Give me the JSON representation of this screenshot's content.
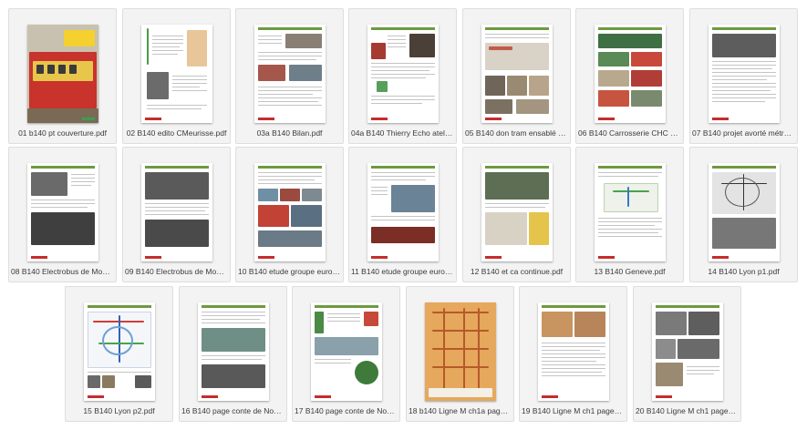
{
  "files": [
    {
      "name": "01 b140 pt couverture.pdf",
      "icon": "pdf-file-icon"
    },
    {
      "name": "02 B140 edito CMeurisse.pdf",
      "icon": "pdf-file-icon"
    },
    {
      "name": "03a B140 Bilan.pdf",
      "icon": "pdf-file-icon"
    },
    {
      "name": "04a B140 Thierry Echo atel.p...",
      "icon": "pdf-file-icon"
    },
    {
      "name": "05 B140 don tram ensablé m...",
      "icon": "pdf-file-icon"
    },
    {
      "name": "06 B140 Carrosserie CHC v2...",
      "icon": "pdf-file-icon"
    },
    {
      "name": "07 B140 projet avorté métro ...",
      "icon": "pdf-file-icon"
    },
    {
      "name": "08 B140 Electrobus de Moda...",
      "icon": "pdf-file-icon"
    },
    {
      "name": "09 B140 Electrobus de Moda...",
      "icon": "pdf-file-icon"
    },
    {
      "name": "10 B140 etude groupe euro p...",
      "icon": "pdf-file-icon"
    },
    {
      "name": "11 B140 etude groupe euro p...",
      "icon": "pdf-file-icon"
    },
    {
      "name": "12 B140 et ca continue.pdf",
      "icon": "pdf-file-icon"
    },
    {
      "name": "13 B140 Geneve.pdf",
      "icon": "pdf-file-icon"
    },
    {
      "name": "14 B140 Lyon p1.pdf",
      "icon": "pdf-file-icon"
    },
    {
      "name": "15 B140 Lyon p2.pdf",
      "icon": "pdf-file-icon"
    },
    {
      "name": "16 B140 page conte de Noel ...",
      "icon": "pdf-file-icon"
    },
    {
      "name": "17 B140 page conte de Noel ...",
      "icon": "pdf-file-icon"
    },
    {
      "name": "18 b140 Ligne M ch1a page1...",
      "icon": "pdf-file-icon"
    },
    {
      "name": "19 B140 Ligne M ch1 page2.p...",
      "icon": "pdf-file-icon"
    },
    {
      "name": "20 B140 Ligne M ch1 page3.p...",
      "icon": "pdf-file-icon"
    }
  ],
  "colors": {
    "tile_background": "#f3f3f3",
    "tile_border": "#dedede",
    "caption_text": "#3b3b3b",
    "header_band": "#6d9a3f",
    "footer_band": "#c62c2c"
  }
}
